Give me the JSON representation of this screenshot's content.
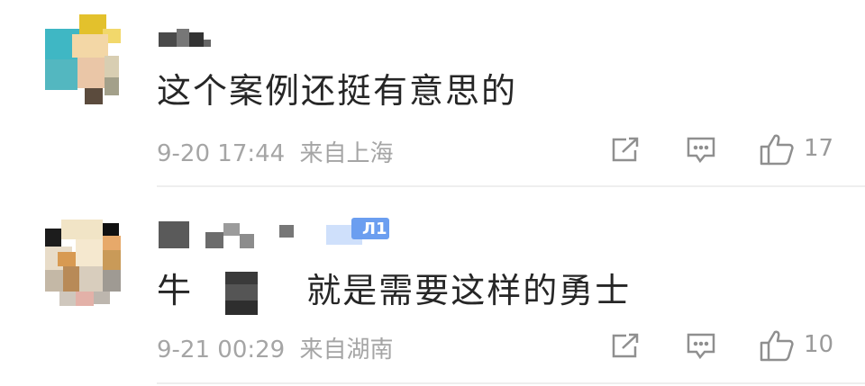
{
  "comments": [
    {
      "content": "这个案例还挺有意思的",
      "timestamp": "9-20 17:44",
      "location": "来自上海",
      "likes": "17",
      "icons": {
        "share": "share-icon",
        "reply": "comment-icon",
        "like": "thumbs-up-icon"
      }
    },
    {
      "badge": "Л1",
      "content_prefix": "牛",
      "content_suffix": "就是需要这样的勇士",
      "timestamp": "9-21 00:29",
      "location": "来自湖南",
      "likes": "10",
      "icons": {
        "share": "share-icon",
        "reply": "comment-icon",
        "like": "thumbs-up-icon"
      }
    }
  ],
  "colors": {
    "text": "#262626",
    "meta": "#a5a5a5",
    "icon": "#8f8f8f",
    "badge": "#5b8def",
    "divider": "#eeeeee"
  }
}
